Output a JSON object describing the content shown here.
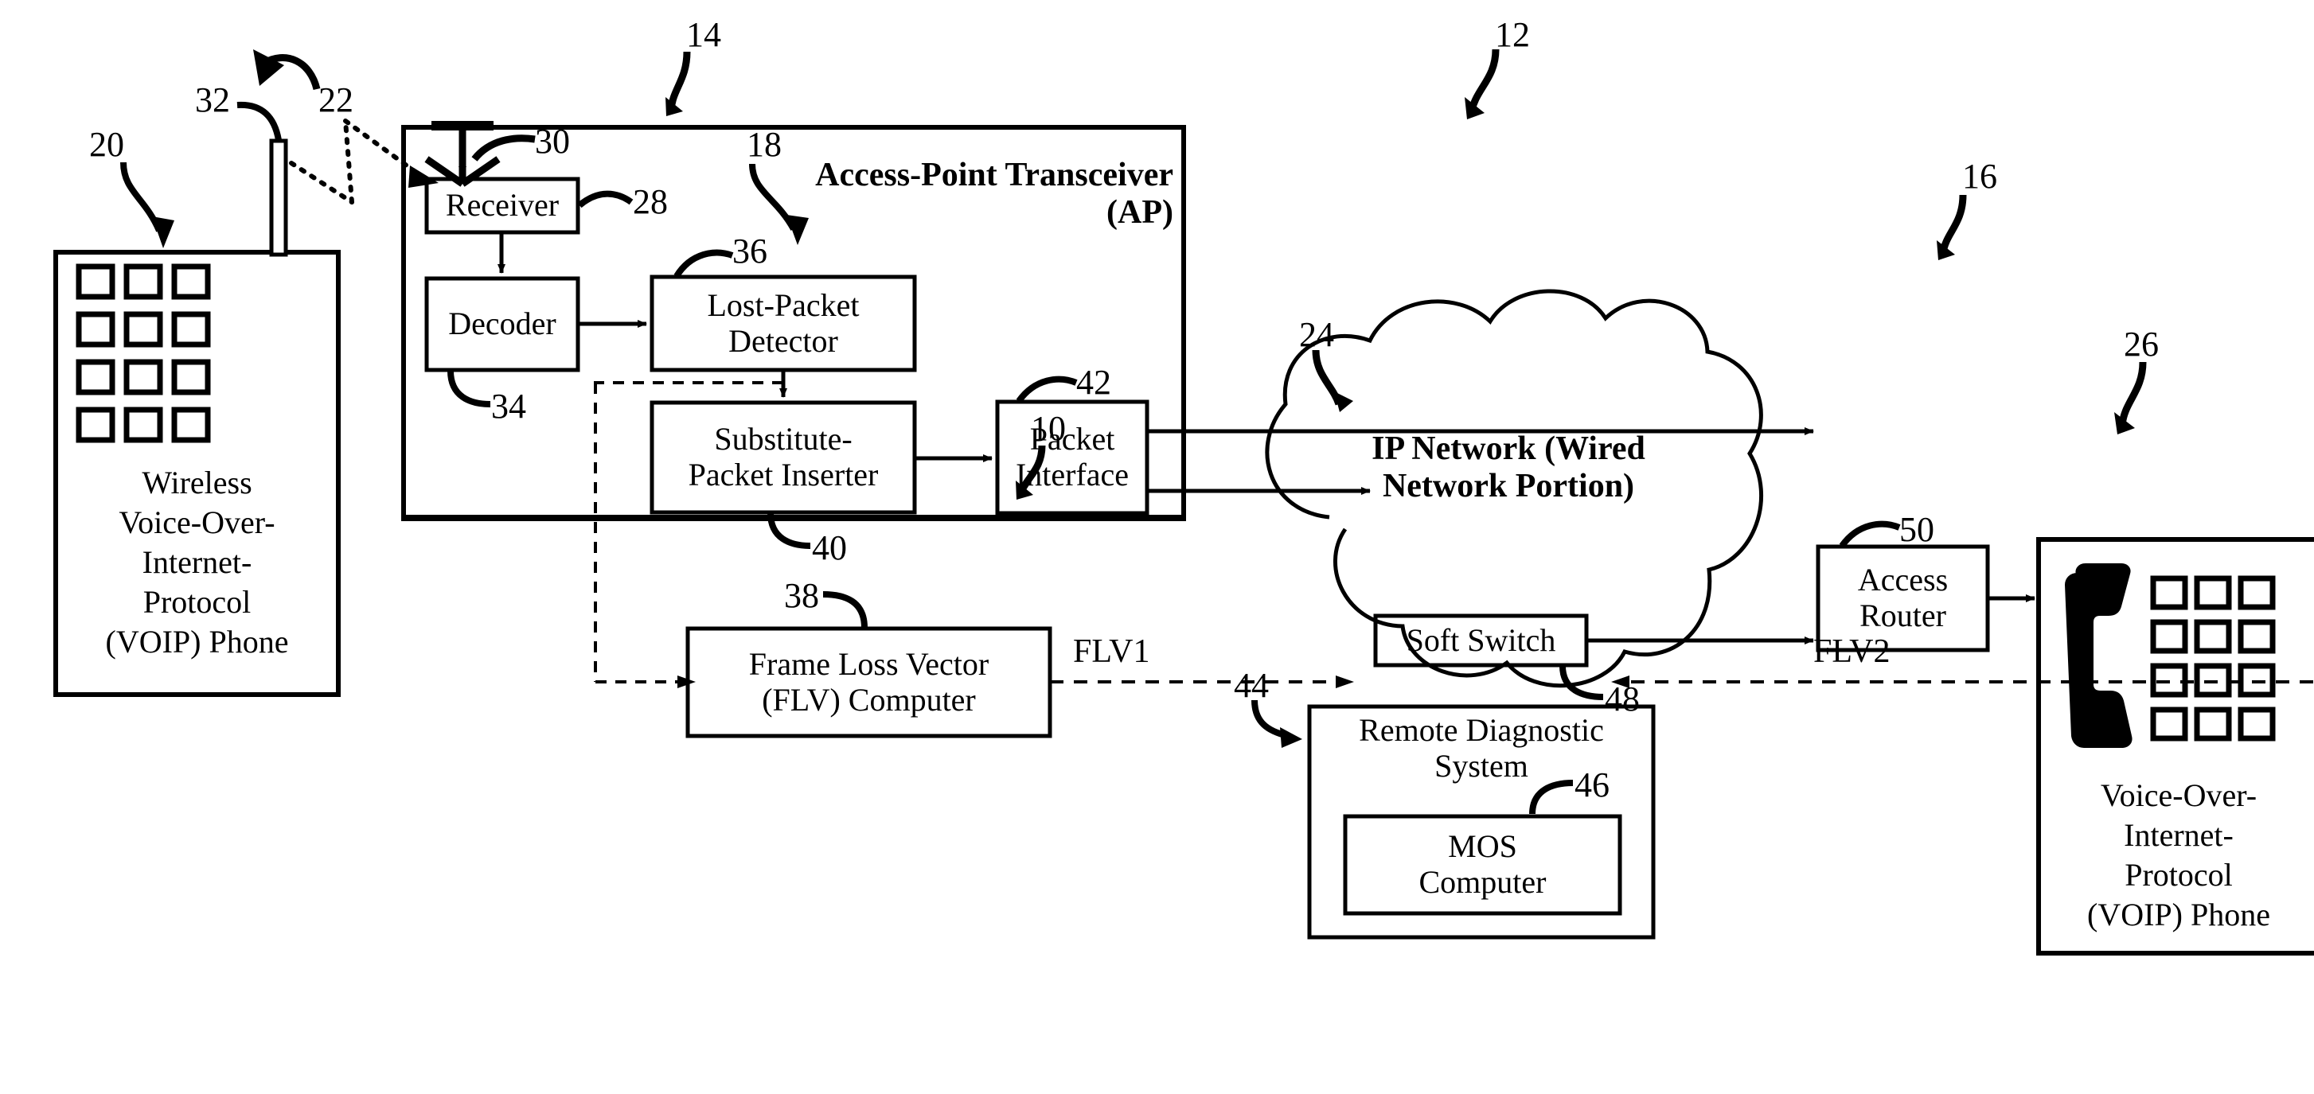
{
  "figure": {
    "type": "patent-block-diagram",
    "title": "VOIP network with access-point transceiver, IP network and remote diagnostic system"
  },
  "nodes": {
    "wireless_phone": {
      "caption": "Wireless\nVoice-Over-\nInternet-\nProtocol\n(VOIP) Phone",
      "ref": "20"
    },
    "phone_antenna": {
      "ref": "32"
    },
    "wireless_link": {
      "ref": "22"
    },
    "ap_antenna": {
      "ref": "30"
    },
    "ap": {
      "title": "Access-Point Transceiver\n(AP)",
      "ref": "18"
    },
    "receiver": {
      "label": "Receiver",
      "ref": "28"
    },
    "decoder": {
      "label": "Decoder",
      "ref": "34"
    },
    "lost_packet_detector": {
      "label": "Lost-Packet\nDetector",
      "ref": "36"
    },
    "substitute_packet_inserter": {
      "label": "Substitute-\nPacket Inserter",
      "ref": "40"
    },
    "packet_interface": {
      "label": "Packet\nInterface",
      "ref": "42"
    },
    "flv_computer": {
      "label": "Frame Loss Vector\n(FLV) Computer",
      "ref": "38"
    },
    "ip_network": {
      "label": "IP Network (Wired\nNetwork Portion)",
      "ref": "24"
    },
    "soft_switch": {
      "label": "Soft Switch",
      "ref": "48"
    },
    "remote_diagnostic_system": {
      "label": "Remote Diagnostic\nSystem",
      "ref": "44"
    },
    "mos_computer": {
      "label": "MOS\nComputer",
      "ref": "46"
    },
    "access_router": {
      "label": "Access\nRouter",
      "ref": "50"
    },
    "voip_phone": {
      "caption": "Voice-Over-\nInternet-\nProtocol\n(VOIP) Phone",
      "ref": "26"
    }
  },
  "signals": {
    "flv1": "FLV1",
    "flv2": "FLV2"
  },
  "refs": {
    "system": "10",
    "wired_side": "12",
    "wireless_side": "14",
    "far_end": "16"
  },
  "colors": {
    "ink": "#000000",
    "background": "#ffffff"
  }
}
